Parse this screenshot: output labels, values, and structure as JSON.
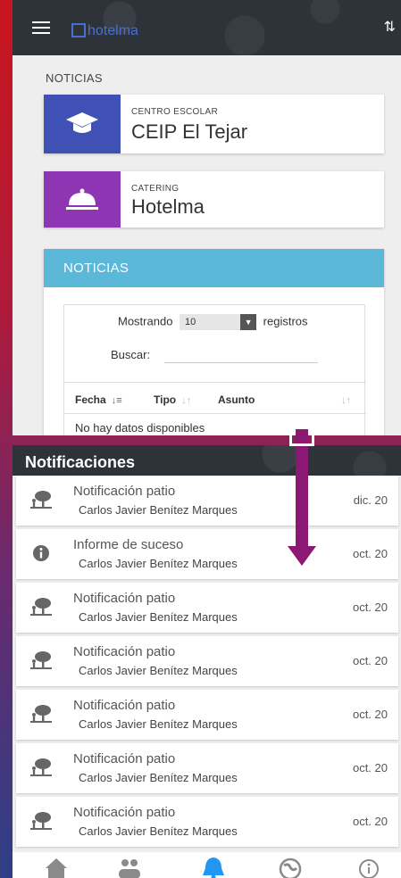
{
  "top": {
    "brand": "hotelma",
    "section_label": "NOTICIAS",
    "cards": [
      {
        "caption": "CENTRO ESCOLAR",
        "title": "CEIP El Tejar",
        "color": "#3f51b5"
      },
      {
        "caption": "CATERING",
        "title": "Hotelma",
        "color": "#8e35b3"
      }
    ],
    "news": {
      "header": "NOTICIAS",
      "showing_prefix": "Mostrando",
      "page_size": "10",
      "showing_suffix": "registros",
      "search_label": "Buscar:",
      "columns": [
        "Fecha",
        "Tipo",
        "Asunto"
      ],
      "empty_text": "No hay datos disponibles"
    }
  },
  "bottom": {
    "header": "Notificaciones",
    "items": [
      {
        "title": "Notificación patio",
        "subtitle": "Carlos Javier Benítez  Marques",
        "date": "dic. 20",
        "icon": "playground-icon"
      },
      {
        "title": "Informe de suceso",
        "subtitle": "Carlos Javier Benítez  Marques",
        "date": "oct. 20",
        "icon": "info-icon"
      },
      {
        "title": "Notificación patio",
        "subtitle": "Carlos Javier Benítez  Marques",
        "date": "oct. 20",
        "icon": "playground-icon"
      },
      {
        "title": "Notificación patio",
        "subtitle": "Carlos Javier Benítez  Marques",
        "date": "oct. 20",
        "icon": "playground-icon"
      },
      {
        "title": "Notificación patio",
        "subtitle": "Carlos Javier Benítez  Marques",
        "date": "oct. 20",
        "icon": "playground-icon"
      },
      {
        "title": "Notificación patio",
        "subtitle": "Carlos Javier Benítez  Marques",
        "date": "oct. 20",
        "icon": "playground-icon"
      },
      {
        "title": "Notificación patio",
        "subtitle": "Carlos Javier Benítez  Marques",
        "date": "oct. 20",
        "icon": "playground-icon"
      }
    ],
    "nav": [
      "home-icon",
      "people-icon",
      "bell-icon",
      "globe-icon",
      "info-icon"
    ]
  },
  "colors": {
    "accent_arrow": "#8b1873",
    "news_header": "#5bb8d8",
    "nav_active": "#2196f3"
  }
}
